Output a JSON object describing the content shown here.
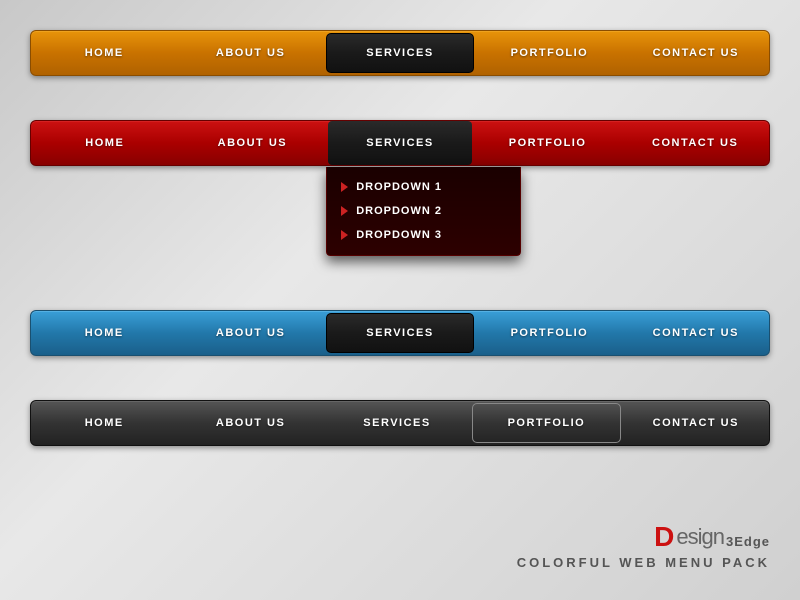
{
  "nav1": {
    "theme": "orange",
    "items": [
      {
        "label": "HOME",
        "active": false
      },
      {
        "label": "ABOUT US",
        "active": false
      },
      {
        "label": "SERVICES",
        "active": true
      },
      {
        "label": "PORTFOLIO",
        "active": false
      },
      {
        "label": "CONTACT US",
        "active": false
      }
    ]
  },
  "nav2": {
    "theme": "red",
    "items": [
      {
        "label": "HOME",
        "active": false
      },
      {
        "label": "ABOUT US",
        "active": false
      },
      {
        "label": "SERVICES",
        "active": true
      },
      {
        "label": "PORTFOLIO",
        "active": false
      },
      {
        "label": "CONTACT US",
        "active": false
      }
    ],
    "dropdown": {
      "items": [
        "DROPDOWN 1",
        "DROPDOWN 2",
        "DROPDOWN 3"
      ]
    }
  },
  "nav3": {
    "theme": "blue",
    "items": [
      {
        "label": "HOME",
        "active": false
      },
      {
        "label": "ABOUT US",
        "active": false
      },
      {
        "label": "SERVICES",
        "active": true
      },
      {
        "label": "PORTFOLIO",
        "active": false
      },
      {
        "label": "CONTACT US",
        "active": false
      }
    ]
  },
  "nav4": {
    "theme": "dark",
    "items": [
      {
        "label": "HOME",
        "active": false
      },
      {
        "label": "ABOUT US",
        "active": false
      },
      {
        "label": "SERVICES",
        "active": false
      },
      {
        "label": "PORTFOLIO",
        "active": true
      },
      {
        "label": "CONTACT US",
        "active": false
      }
    ]
  },
  "brand": {
    "logo_d": "D",
    "logo_esign": "esign",
    "logo_3edge": "3Edge",
    "tagline": "COLORFUL WEB MENU PACK"
  }
}
